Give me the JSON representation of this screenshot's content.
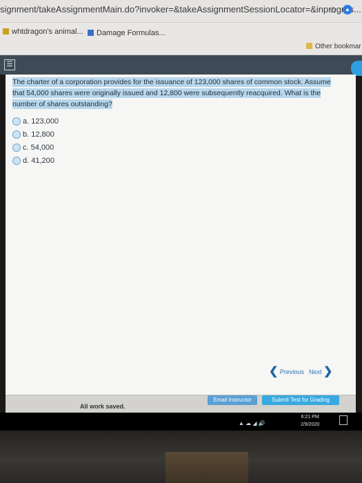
{
  "browser": {
    "url": "signment/takeAssignmentMain.do?invoker=&takeAssignmentSessionLocator=&inprogres...",
    "star_icon": "star-icon",
    "profile_icon": "profile-icon",
    "bookmarks": [
      {
        "label": "whtdragon's animal...",
        "icon": "bookmark-icon"
      },
      {
        "label": "Damage Formulas...",
        "icon": "bookmark-icon"
      },
      {
        "label": "Other bookmar",
        "icon": "folder-icon"
      }
    ]
  },
  "app": {
    "menu_icon": "menu-icon",
    "help_icon": "help-tab-icon"
  },
  "question": {
    "text": "The charter of a corporation provides for the issuance of 123,000 shares of common stock. Assume that 54,000 shares were originally issued and 12,800 were subsequently reacquired. What is the number of shares outstanding?",
    "options": [
      {
        "letter": "a.",
        "value": "123,000"
      },
      {
        "letter": "b.",
        "value": "12,800"
      },
      {
        "letter": "c.",
        "value": "54,000"
      },
      {
        "letter": "d.",
        "value": "41,200"
      }
    ]
  },
  "navigation": {
    "previous_label": "Previous",
    "next_label": "Next"
  },
  "footer": {
    "status": "All work saved.",
    "email_button": "Email Instructor",
    "submit_button": "Submit Test for Grading"
  },
  "taskbar": {
    "time": "6:21 PM",
    "date": "2/9/2020"
  },
  "colors": {
    "app_header": "#3e4a55",
    "highlight": "#b8d6ec",
    "button_blue": "#39a9de",
    "link_blue": "#2b76b8"
  }
}
